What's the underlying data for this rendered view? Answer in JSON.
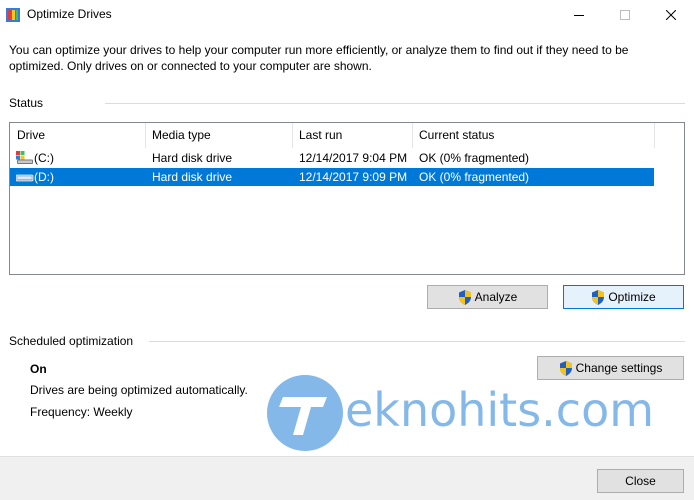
{
  "window": {
    "title": "Optimize Drives",
    "icons": {
      "app": "optimize-drives-icon",
      "minimize": "minimize-icon",
      "maximize": "maximize-icon",
      "close": "close-icon"
    }
  },
  "description": "You can optimize your drives to help your computer run more efficiently, or analyze them to find out if they need to be optimized. Only drives on or connected to your computer are shown.",
  "status": {
    "label": "Status",
    "columns": [
      "Drive",
      "Media type",
      "Last run",
      "Current status"
    ],
    "drives": [
      {
        "drive": "(C:)",
        "media_type": "Hard disk drive",
        "last_run": "12/14/2017 9:04 PM",
        "current_status": "OK (0% fragmented)",
        "icon": "system-drive-icon",
        "selected": false
      },
      {
        "drive": "(D:)",
        "media_type": "Hard disk drive",
        "last_run": "12/14/2017 9:09 PM",
        "current_status": "OK (0% fragmented)",
        "icon": "hard-drive-icon",
        "selected": true
      }
    ]
  },
  "buttons": {
    "analyze": "Analyze",
    "optimize": "Optimize",
    "change_settings": "Change settings",
    "close": "Close"
  },
  "scheduled": {
    "label": "Scheduled optimization",
    "state": "On",
    "description": "Drives are being optimized automatically.",
    "frequency": "Frequency: Weekly"
  },
  "watermark": {
    "text": "eknohits.com"
  },
  "colors": {
    "selection": "#0078d7",
    "shield_blue": "#1f5fbf",
    "shield_yellow": "#f5c21b",
    "watermark": "#1e7fd6"
  }
}
